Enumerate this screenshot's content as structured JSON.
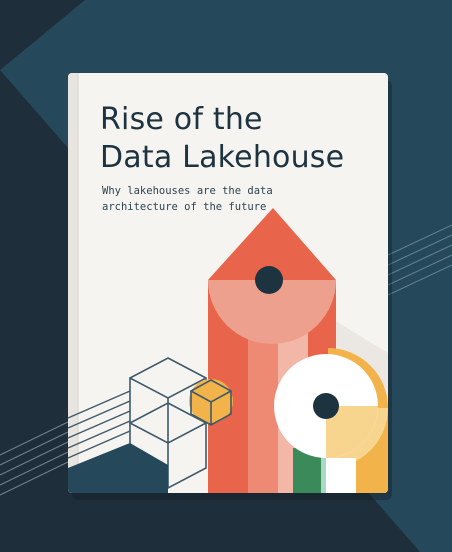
{
  "book": {
    "title_line1": "Rise of the",
    "title_line2": "Data Lakehouse",
    "subtitle_line1": "Why lakehouses are the data",
    "subtitle_line2": "architecture of the future"
  },
  "colors": {
    "background_dark": "#1e2e3a",
    "background_band": "#25485a",
    "cover": "#f6f4f1",
    "coral": "#e8644a",
    "salmon": "#eea08e",
    "teal_dark": "#1d3340",
    "yellow": "#f2b34a",
    "pale_yellow": "#f7d58f",
    "green": "#3b8a5a",
    "mint": "#a9d9c4"
  }
}
